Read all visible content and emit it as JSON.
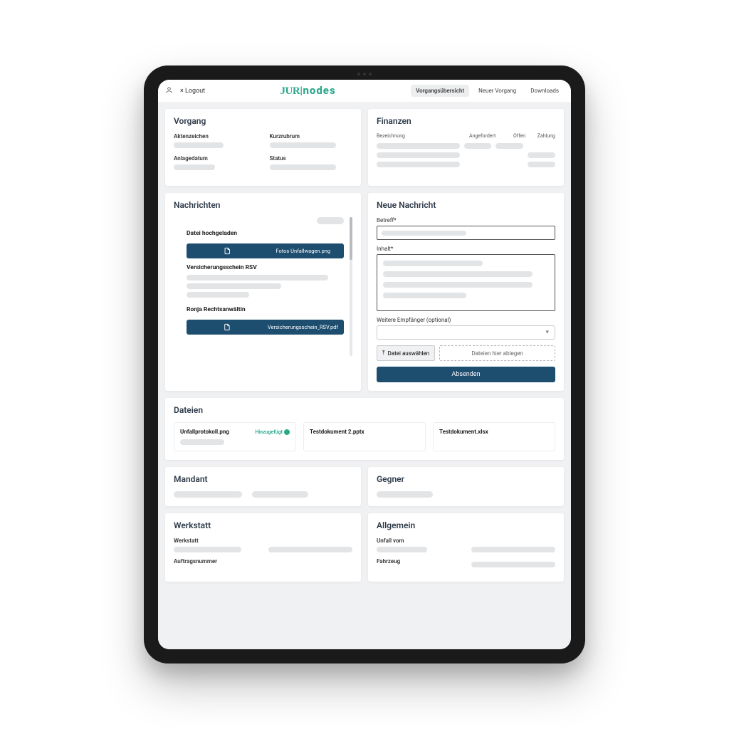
{
  "header": {
    "logout": "Logout",
    "logo_jur": "JUR",
    "logo_bar": "|",
    "logo_nodes": "nodes",
    "tabs": {
      "overview": "Vorgangsübersicht",
      "new": "Neuer Vorgang",
      "downloads": "Downloads"
    }
  },
  "cards": {
    "vorgang": {
      "title": "Vorgang",
      "fields": {
        "aktenzeichen": "Aktenzeichen",
        "kurzrubrum": "Kurzrubrum",
        "anlagedatum": "Anlagedatum",
        "status": "Status"
      }
    },
    "finanzen": {
      "title": "Finanzen",
      "columns": {
        "bezeichnung": "Bezeichnung",
        "angefordert": "Angefordert",
        "offen": "Offen",
        "zahlung": "Zahlung"
      }
    },
    "nachrichten": {
      "title": "Nachrichten",
      "items": [
        {
          "title": "Datei hochgeladen",
          "attachment": "Fotos Unfallwagen.png"
        },
        {
          "title": "Versicherungsschein RSV"
        },
        {
          "title": "Ronja Rechtsanwältin",
          "attachment": "Versicherungsschein_RSV.pdf"
        }
      ]
    },
    "neue_nachricht": {
      "title": "Neue Nachricht",
      "betreff_label": "Betreff*",
      "inhalt_label": "Inhalt*",
      "empfaenger_label": "Weitere Empfänger (optional)",
      "file_button": "Datei auswählen",
      "drop_text": "Dateien hier ablegen",
      "submit": "Absenden"
    },
    "dateien": {
      "title": "Dateien",
      "files": [
        {
          "name": "Unfallprotokoll.png",
          "tag": "Hinzugefügt"
        },
        {
          "name": "Testdokument 2.pptx"
        },
        {
          "name": "Testdokument.xlsx"
        }
      ]
    },
    "mandant": {
      "title": "Mandant"
    },
    "gegner": {
      "title": "Gegner"
    },
    "werkstatt": {
      "title": "Werkstatt",
      "fields": {
        "werkstatt": "Werkstatt",
        "auftragsnummer": "Auftragsnummer"
      }
    },
    "allgemein": {
      "title": "Allgemein",
      "fields": {
        "unfall_vom": "Unfall vom",
        "fahrzeug": "Fahrzeug"
      }
    }
  }
}
